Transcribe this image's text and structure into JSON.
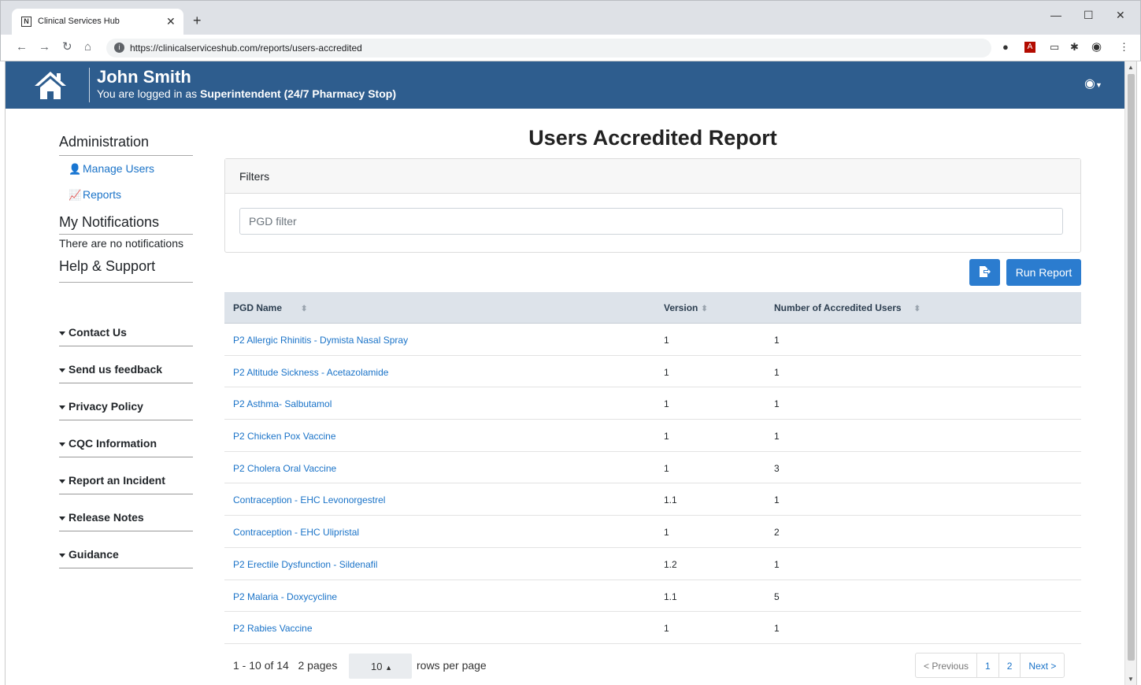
{
  "browser": {
    "tab_title": "Clinical Services Hub",
    "url": "https://clinicalserviceshub.com/reports/users-accredited"
  },
  "header": {
    "user_name": "John Smith",
    "logged_in_prefix": "You are logged in as ",
    "logged_in_role": "Superintendent (24/7 Pharmacy Stop)"
  },
  "sidebar": {
    "administration_heading": "Administration",
    "manage_users": "Manage Users",
    "reports": "Reports",
    "notifications_heading": "My Notifications",
    "no_notifications": "There are no notifications",
    "help_heading": "Help & Support",
    "items": [
      "Contact Us",
      "Send us feedback",
      "Privacy Policy",
      "CQC Information",
      "Report an Incident",
      "Release Notes",
      "Guidance"
    ]
  },
  "main": {
    "title": "Users Accredited Report",
    "filters_heading": "Filters",
    "filter_placeholder": "PGD filter",
    "run_report": "Run Report",
    "columns": [
      "PGD Name",
      "Version",
      "Number of Accredited Users"
    ],
    "rows": [
      {
        "name": "P2 Allergic Rhinitis - Dymista Nasal Spray",
        "version": "1",
        "users": "1"
      },
      {
        "name": "P2 Altitude Sickness - Acetazolamide",
        "version": "1",
        "users": "1"
      },
      {
        "name": "P2 Asthma- Salbutamol",
        "version": "1",
        "users": "1"
      },
      {
        "name": "P2 Chicken Pox Vaccine",
        "version": "1",
        "users": "1"
      },
      {
        "name": "P2 Cholera Oral Vaccine",
        "version": "1",
        "users": "3"
      },
      {
        "name": "Contraception - EHC Levonorgestrel",
        "version": "1.1",
        "users": "1"
      },
      {
        "name": "Contraception - EHC Ulipristal",
        "version": "1",
        "users": "2"
      },
      {
        "name": "P2 Erectile Dysfunction - Sildenafil",
        "version": "1.2",
        "users": "1"
      },
      {
        "name": "P2 Malaria - Doxycycline",
        "version": "1.1",
        "users": "5"
      },
      {
        "name": "P2 Rabies Vaccine",
        "version": "1",
        "users": "1"
      }
    ],
    "pager": {
      "range": "1 - 10 of 14",
      "pages": "2 pages",
      "rows_per_page_value": "10",
      "rows_per_page_label": "rows per page",
      "previous": "< Previous",
      "page_1": "1",
      "page_2": "2",
      "next": "Next >"
    }
  },
  "colors": {
    "header_bg": "#2e5d8e",
    "accent": "#2b7ccf",
    "link": "#1a73c8"
  }
}
